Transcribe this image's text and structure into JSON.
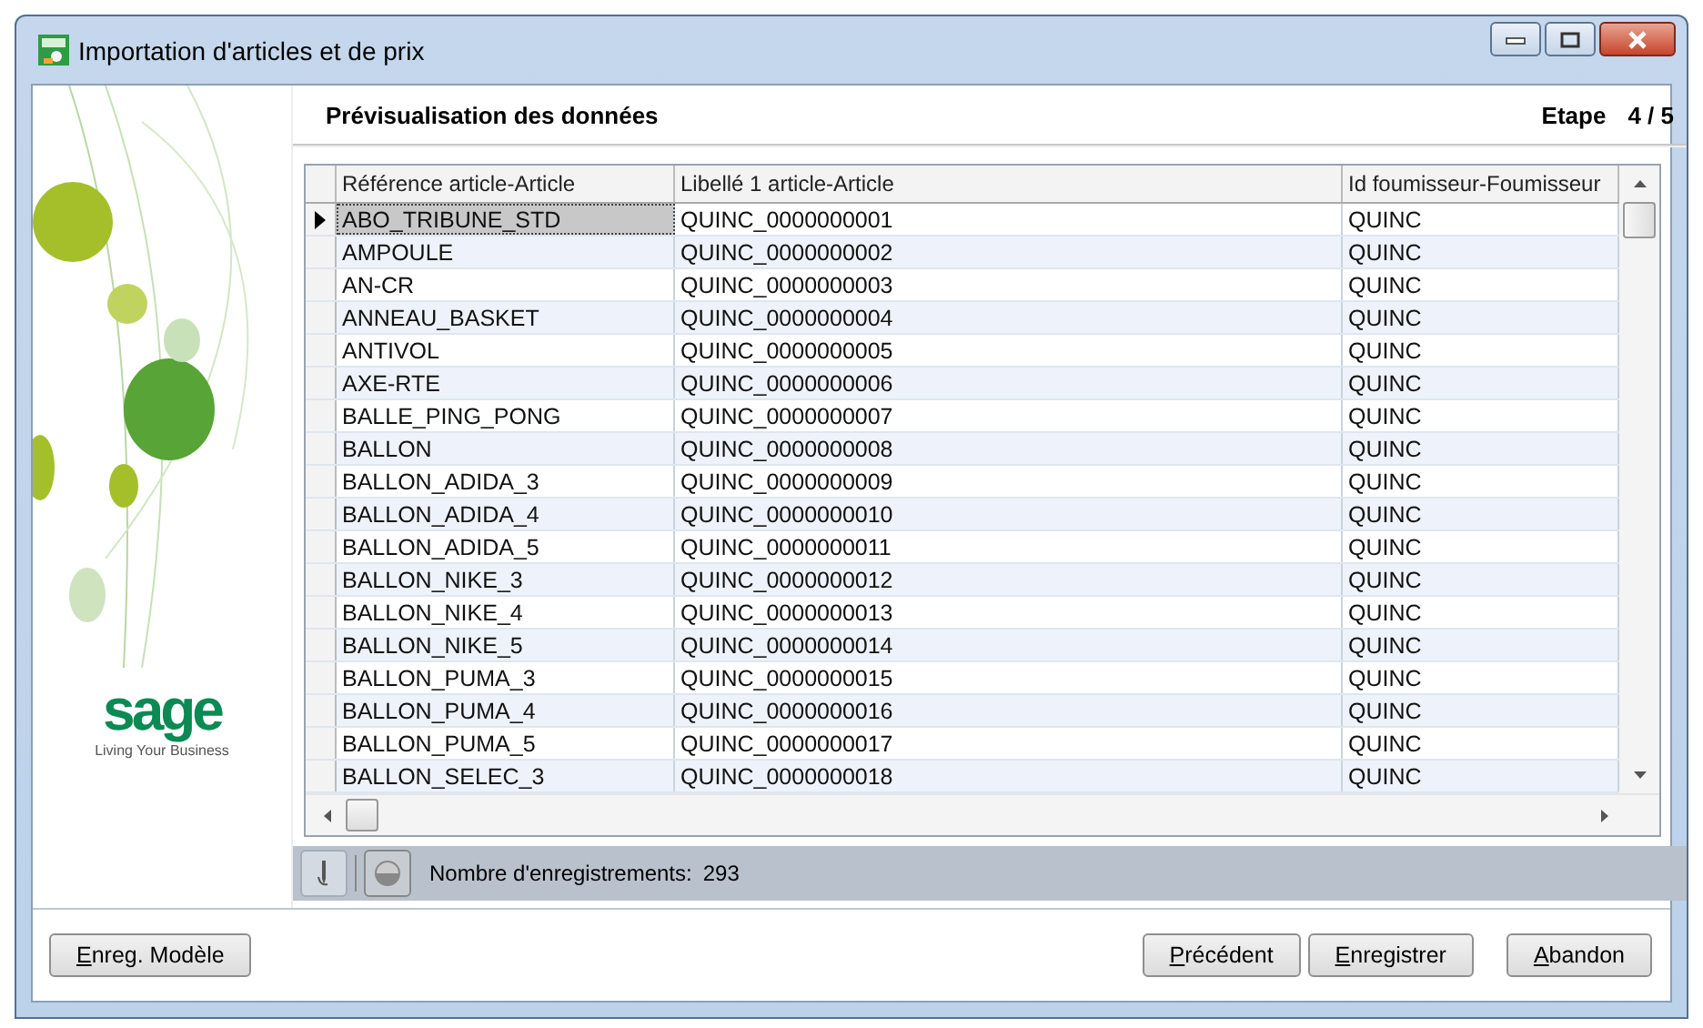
{
  "window": {
    "title": "Importation d'articles et de prix"
  },
  "brand": {
    "logo": "sage",
    "tagline": "Living Your Business"
  },
  "header": {
    "title": "Prévisualisation des données",
    "step_label": "Etape",
    "step": "4 / 5"
  },
  "table": {
    "columns": [
      "Référence article-Article",
      "Libellé 1 article-Article",
      "Id foumisseur-Foumisseur"
    ],
    "rows": [
      {
        "cells": [
          "ABO_TRIBUNE_STD",
          "QUINC_0000000001",
          "QUINC"
        ],
        "selected": true
      },
      {
        "cells": [
          "AMPOULE",
          "QUINC_0000000002",
          "QUINC"
        ],
        "selected": false
      },
      {
        "cells": [
          "AN-CR",
          "QUINC_0000000003",
          "QUINC"
        ],
        "selected": false
      },
      {
        "cells": [
          "ANNEAU_BASKET",
          "QUINC_0000000004",
          "QUINC"
        ],
        "selected": false
      },
      {
        "cells": [
          "ANTIVOL",
          "QUINC_0000000005",
          "QUINC"
        ],
        "selected": false
      },
      {
        "cells": [
          "AXE-RTE",
          "QUINC_0000000006",
          "QUINC"
        ],
        "selected": false
      },
      {
        "cells": [
          "BALLE_PING_PONG",
          "QUINC_0000000007",
          "QUINC"
        ],
        "selected": false
      },
      {
        "cells": [
          "BALLON",
          "QUINC_0000000008",
          "QUINC"
        ],
        "selected": false
      },
      {
        "cells": [
          "BALLON_ADIDA_3",
          "QUINC_0000000009",
          "QUINC"
        ],
        "selected": false
      },
      {
        "cells": [
          "BALLON_ADIDA_4",
          "QUINC_0000000010",
          "QUINC"
        ],
        "selected": false
      },
      {
        "cells": [
          "BALLON_ADIDA_5",
          "QUINC_0000000011",
          "QUINC"
        ],
        "selected": false
      },
      {
        "cells": [
          "BALLON_NIKE_3",
          "QUINC_0000000012",
          "QUINC"
        ],
        "selected": false
      },
      {
        "cells": [
          "BALLON_NIKE_4",
          "QUINC_0000000013",
          "QUINC"
        ],
        "selected": false
      },
      {
        "cells": [
          "BALLON_NIKE_5",
          "QUINC_0000000014",
          "QUINC"
        ],
        "selected": false
      },
      {
        "cells": [
          "BALLON_PUMA_3",
          "QUINC_0000000015",
          "QUINC"
        ],
        "selected": false
      },
      {
        "cells": [
          "BALLON_PUMA_4",
          "QUINC_0000000016",
          "QUINC"
        ],
        "selected": false
      },
      {
        "cells": [
          "BALLON_PUMA_5",
          "QUINC_0000000017",
          "QUINC"
        ],
        "selected": false
      },
      {
        "cells": [
          "BALLON_SELEC_3",
          "QUINC_0000000018",
          "QUINC"
        ],
        "selected": false
      }
    ]
  },
  "status": {
    "label": "Nombre d'enregistrements:",
    "count": "293"
  },
  "buttons_left": [
    "Enreg. Modèle"
  ],
  "buttons_right": [
    "Précédent",
    "Enregistrer",
    "Abandon"
  ]
}
